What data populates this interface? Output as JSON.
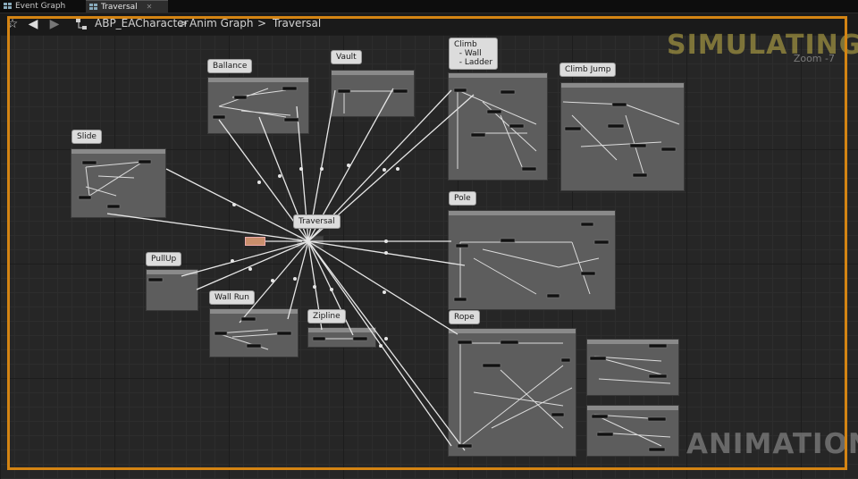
{
  "tabs": [
    {
      "label": "Event Graph",
      "active": false,
      "icon": "graph-grid-icon"
    },
    {
      "label": "Traversal",
      "active": true,
      "icon": "graph-grid-icon"
    }
  ],
  "breadcrumb": {
    "root": "ABP_EACharacter",
    "sep1": ">",
    "parent": "Anim Graph",
    "sep2": ">",
    "current": "Traversal"
  },
  "overlay": {
    "top_right": "SIMULATING",
    "bottom_right": "ANIMATION",
    "zoom": "Zoom -7"
  },
  "colors": {
    "frame": "#d48413",
    "simulating": "#c6b44a",
    "animation": "#b8b8b8"
  },
  "states": {
    "slide": "Slide",
    "ballance": "Ballance",
    "vault": "Vault",
    "climb": "Climb\n  - Wall\n  - Ladder",
    "climb_jump": "Climb Jump",
    "traversal": "Traversal",
    "pole": "Pole",
    "pullup": "PullUp",
    "wall_run": "Wall Run",
    "zipline": "Zipline",
    "rope": "Rope"
  }
}
